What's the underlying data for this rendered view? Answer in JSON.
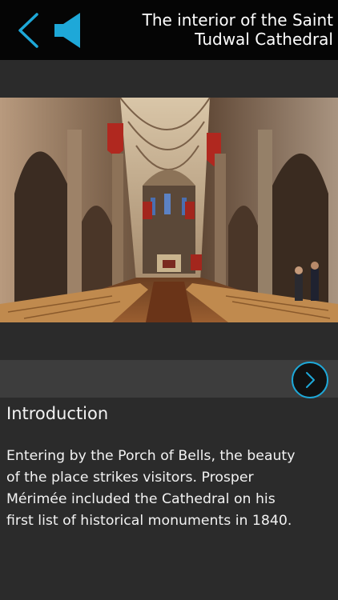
{
  "header": {
    "title_line1": "The interior of the Saint",
    "title_line2": "Tudwal Cathedral",
    "back_icon": "chevron-left-icon",
    "sound_icon": "speaker-icon",
    "accent_color": "#1ea8d8"
  },
  "photo": {
    "subject": "cathedral-nave-photo"
  },
  "navigation": {
    "next_icon": "chevron-right-icon"
  },
  "content": {
    "section_title": "Introduction",
    "body_lines": [
      "Entering by the Porch of Bells, the beauty",
      "of the place strikes visitors. Prosper",
      "Mérimée included the Cathedral on his",
      "first list of historical monuments in 1840."
    ]
  }
}
